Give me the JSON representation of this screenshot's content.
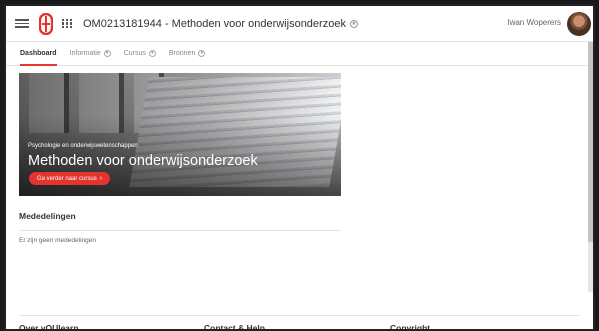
{
  "header": {
    "course_title": "OM0213181944 - Methoden voor onderwijsonderzoek",
    "user_name": "Iwan Woperers",
    "icons": [
      "menu-icon",
      "logo",
      "apps-grid-icon",
      "star-icon",
      "avatar"
    ]
  },
  "tabs": [
    {
      "label": "Dashboard",
      "active": true
    },
    {
      "label": "Informatie",
      "dropdown": true
    },
    {
      "label": "Cursus",
      "dropdown": true
    },
    {
      "label": "Bronnen",
      "dropdown": true
    }
  ],
  "hero": {
    "subtitle": "Psychologie en onderwijswetenschappen",
    "title": "Methoden voor onderwijsonderzoek",
    "button_label": "Ga verder naar cursus"
  },
  "announcements": {
    "heading": "Mededelingen",
    "empty_text": "Er zijn geen mededelingen"
  },
  "footer": {
    "col1": "Over yOUlearn",
    "col2": "Contact & Help",
    "col3": "Copyright"
  },
  "colors": {
    "accent": "#e3342f"
  }
}
